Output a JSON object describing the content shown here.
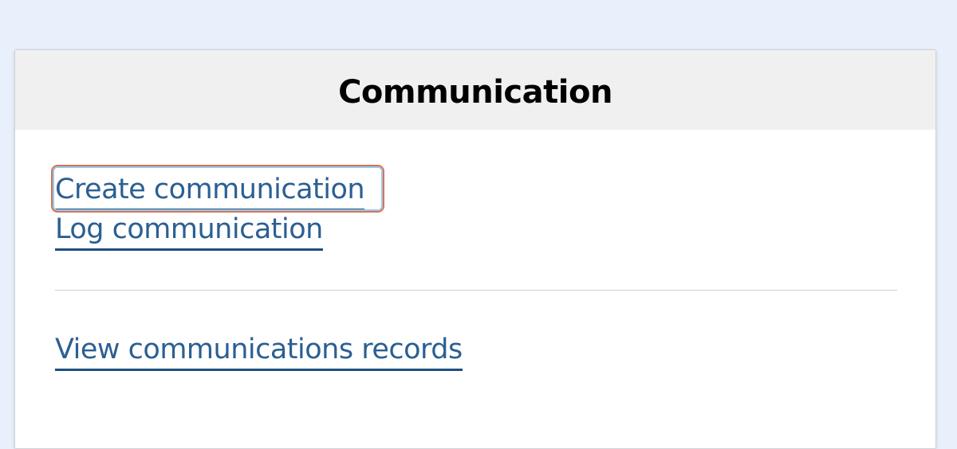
{
  "panel": {
    "title": "Communication",
    "links": {
      "create": "Create communication",
      "log": "Log communication",
      "view_records": "View communications records"
    }
  },
  "colors": {
    "page_background": "#e8f0fc",
    "header_background": "#f0f0f0",
    "link": "#2b5f92",
    "focus_ring": "#e2704f"
  }
}
